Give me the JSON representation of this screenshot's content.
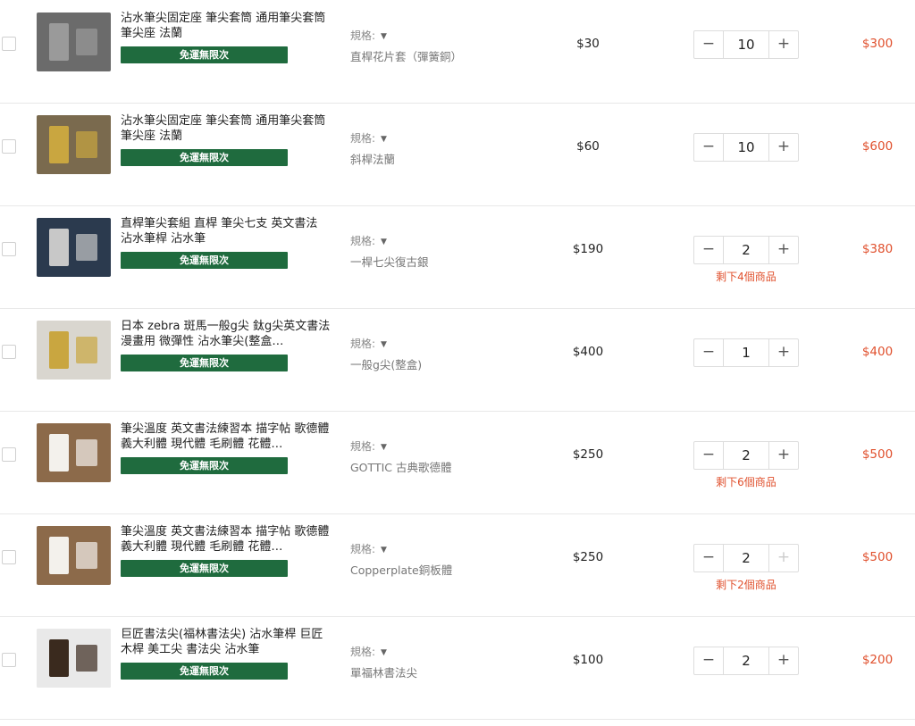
{
  "labels": {
    "spec": "規格:",
    "caret": "▼",
    "free_shipping": "免運無限次",
    "decrease": "−",
    "increase": "+"
  },
  "items": [
    {
      "title": "沾水筆尖固定座 筆尖套筒 通用筆尖套筒 筆尖座 法蘭",
      "spec_value": "直桿花片套（彈簧銅）",
      "unit_price": "$30",
      "quantity": "10",
      "stock_note": "",
      "subtotal": "$300",
      "increase_disabled": false,
      "thumb_colors": [
        "#6b6b6b",
        "#9a9a9a"
      ]
    },
    {
      "title": "沾水筆尖固定座 筆尖套筒 通用筆尖套筒 筆尖座 法蘭",
      "spec_value": "斜桿法蘭",
      "unit_price": "$60",
      "quantity": "10",
      "stock_note": "",
      "subtotal": "$600",
      "increase_disabled": false,
      "thumb_colors": [
        "#7a6a4e",
        "#c9a640"
      ]
    },
    {
      "title": "直桿筆尖套組 直桿 筆尖七支 英文書法 沾水筆桿 沾水筆",
      "spec_value": "一桿七尖復古銀",
      "unit_price": "$190",
      "quantity": "2",
      "stock_note": "剩下4個商品",
      "subtotal": "$380",
      "increase_disabled": false,
      "thumb_colors": [
        "#2b3a4e",
        "#c8c8c8"
      ]
    },
    {
      "title": "日本 zebra 斑馬一般g尖 鈦g尖英文書法 漫畫用 微彈性 沾水筆尖(整盒…",
      "spec_value": "一般g尖(整盒)",
      "unit_price": "$400",
      "quantity": "1",
      "stock_note": "",
      "subtotal": "$400",
      "increase_disabled": false,
      "thumb_colors": [
        "#d9d6cf",
        "#c9a640"
      ]
    },
    {
      "title": "筆尖溫度 英文書法練習本 描字帖 歌德體 義大利體 現代體 毛刷體 花體…",
      "spec_value": "GOTTIC 古典歌德體",
      "unit_price": "$250",
      "quantity": "2",
      "stock_note": "剩下6個商品",
      "subtotal": "$500",
      "increase_disabled": false,
      "thumb_colors": [
        "#8c6a4a",
        "#f3f1ec"
      ]
    },
    {
      "title": "筆尖溫度 英文書法練習本 描字帖 歌德體 義大利體 現代體 毛刷體 花體…",
      "spec_value": "Copperplate銅板體",
      "unit_price": "$250",
      "quantity": "2",
      "stock_note": "剩下2個商品",
      "subtotal": "$500",
      "increase_disabled": true,
      "thumb_colors": [
        "#8c6a4a",
        "#f3f1ec"
      ]
    },
    {
      "title": "巨匠書法尖(福林書法尖) 沾水筆桿 巨匠木桿 美工尖 書法尖 沾水筆",
      "spec_value": "單福林書法尖",
      "unit_price": "$100",
      "quantity": "2",
      "stock_note": "",
      "subtotal": "$200",
      "increase_disabled": false,
      "thumb_colors": [
        "#e9e9e9",
        "#3a2a1e"
      ]
    }
  ]
}
